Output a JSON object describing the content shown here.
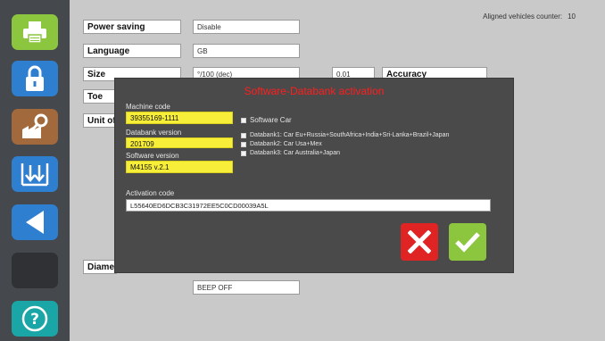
{
  "colors": {
    "sidebar_bg": "#45484c",
    "main_bg": "#c9c9c9",
    "dialog_bg": "#4a4a4a",
    "title_red": "#ff1e1e",
    "highlight_yellow": "#f6ee38",
    "green": "#8cc63f",
    "cancel_red": "#e02424",
    "blue": "#2f7fd1",
    "brown": "#a26a3c"
  },
  "sidebar": {
    "items": [
      {
        "icon": "printer-icon"
      },
      {
        "icon": "lock-icon"
      },
      {
        "icon": "wrench-factory-icon"
      },
      {
        "icon": "download-arrows-icon"
      },
      {
        "icon": "back-arrow-icon"
      },
      {
        "icon": "blank-button"
      },
      {
        "icon": "help-icon",
        "glyph": "?"
      }
    ]
  },
  "header": {
    "counter_label": "Aligned vehicles counter:",
    "counter_value": "10"
  },
  "settings": {
    "power_saving": {
      "label": "Power saving",
      "value": "Disable"
    },
    "language": {
      "label": "Language",
      "value": "GB"
    },
    "size": {
      "label": "Size",
      "value": "°/100 (dec)"
    },
    "accuracy": {
      "label": "Accuracy",
      "value": "0.01"
    },
    "toe": {
      "label": "Toe"
    },
    "unit_of": {
      "label": "Unit of"
    },
    "diameter": {
      "label": "Diamet"
    },
    "beep": {
      "value": "BEEP OFF"
    }
  },
  "dialog": {
    "title": "Software-Databank activation",
    "machine_code": {
      "caption": "Machine code",
      "value": "39355169-1111"
    },
    "databank_version": {
      "caption": "Databank version",
      "value": "201709"
    },
    "software_version": {
      "caption": "Software version",
      "value": "M4155 v.2.1"
    },
    "options": [
      {
        "label": "Software Car"
      },
      {
        "label": "Databank1: Car Eu+Russia+SouthAfrica+India+Sri-Lanka+Brazil+Japan"
      },
      {
        "label": "Databank2: Car Usa+Mex"
      },
      {
        "label": "Databank3: Car Australia+Japan"
      }
    ],
    "activation": {
      "caption": "Activation code",
      "value": "L55640ED6DCB3C31972EE5C0CD00039A5L"
    }
  }
}
